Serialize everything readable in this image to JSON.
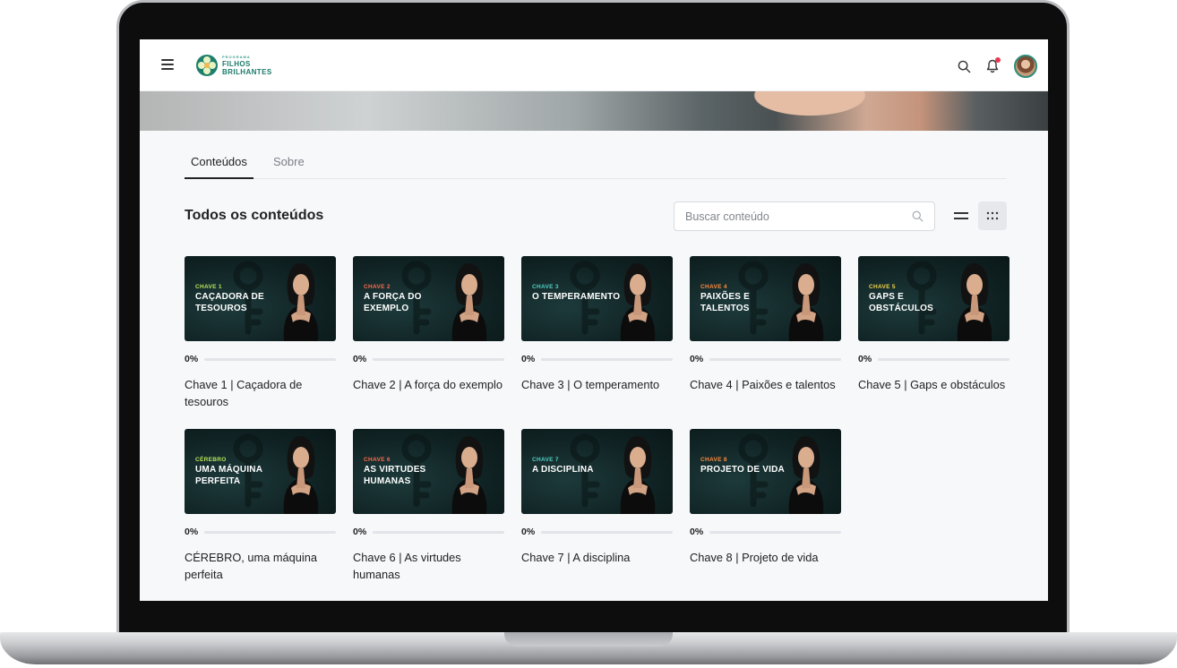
{
  "app": {
    "logo_small": "PROGRAMA",
    "logo_line1": "FILHOS",
    "logo_line2": "BRILHANTES",
    "accent_color": "#2b8c7a",
    "notification_dot_color": "#e63950"
  },
  "tabs": [
    {
      "label": "Conteúdos",
      "active": true
    },
    {
      "label": "Sobre",
      "active": false
    }
  ],
  "section": {
    "title": "Todos os conteúdos",
    "search_placeholder": "Buscar conteúdo"
  },
  "icons": {
    "menu": "hamburger-icon",
    "search": "search-icon",
    "notifications": "bell-icon",
    "list_view": "list-view-icon",
    "grid_view": "grid-view-icon"
  },
  "cards": [
    {
      "chave": "CHAVE 1",
      "chave_color": "#b6e35a",
      "thumb_title": "CAÇADORA DE TESOUROS",
      "progress_label": "0%",
      "progress": 0,
      "title": "Chave 1 | Caçadora de tesouros"
    },
    {
      "chave": "CHAVE 2",
      "chave_color": "#ff6a4a",
      "thumb_title": "A FORÇA DO EXEMPLO",
      "progress_label": "0%",
      "progress": 0,
      "title": "Chave 2 | A força do exemplo"
    },
    {
      "chave": "CHAVE 3",
      "chave_color": "#4fd1c5",
      "thumb_title": "O TEMPERAMENTO",
      "progress_label": "0%",
      "progress": 0,
      "title": "Chave 3 | O temperamento"
    },
    {
      "chave": "CHAVE 4",
      "chave_color": "#ff8a3d",
      "thumb_title": "PAIXÕES E TALENTOS",
      "progress_label": "0%",
      "progress": 0,
      "title": "Chave 4 | Paixões e talentos"
    },
    {
      "chave": "CHAVE 5",
      "chave_color": "#f2d64b",
      "thumb_title": "GAPS E OBSTÁCULOS",
      "progress_label": "0%",
      "progress": 0,
      "title": "Chave 5 | Gaps e obstáculos"
    },
    {
      "chave": "CÉREBRO",
      "chave_color": "#b6e35a",
      "thumb_title": "UMA MÁQUINA PERFEITA",
      "progress_label": "0%",
      "progress": 0,
      "title": "CÉREBRO, uma máquina perfeita"
    },
    {
      "chave": "CHAVE 6",
      "chave_color": "#ff6a4a",
      "thumb_title": "AS VIRTUDES HUMANAS",
      "progress_label": "0%",
      "progress": 0,
      "title": "Chave 6 | As virtudes humanas"
    },
    {
      "chave": "CHAVE 7",
      "chave_color": "#4fd1c5",
      "thumb_title": "A DISCIPLINA",
      "progress_label": "0%",
      "progress": 0,
      "title": "Chave 7 | A disciplina"
    },
    {
      "chave": "CHAVE 8",
      "chave_color": "#ff8a3d",
      "thumb_title": "PROJETO DE VIDA",
      "progress_label": "0%",
      "progress": 0,
      "title": "Chave 8 | Projeto de vida"
    }
  ]
}
